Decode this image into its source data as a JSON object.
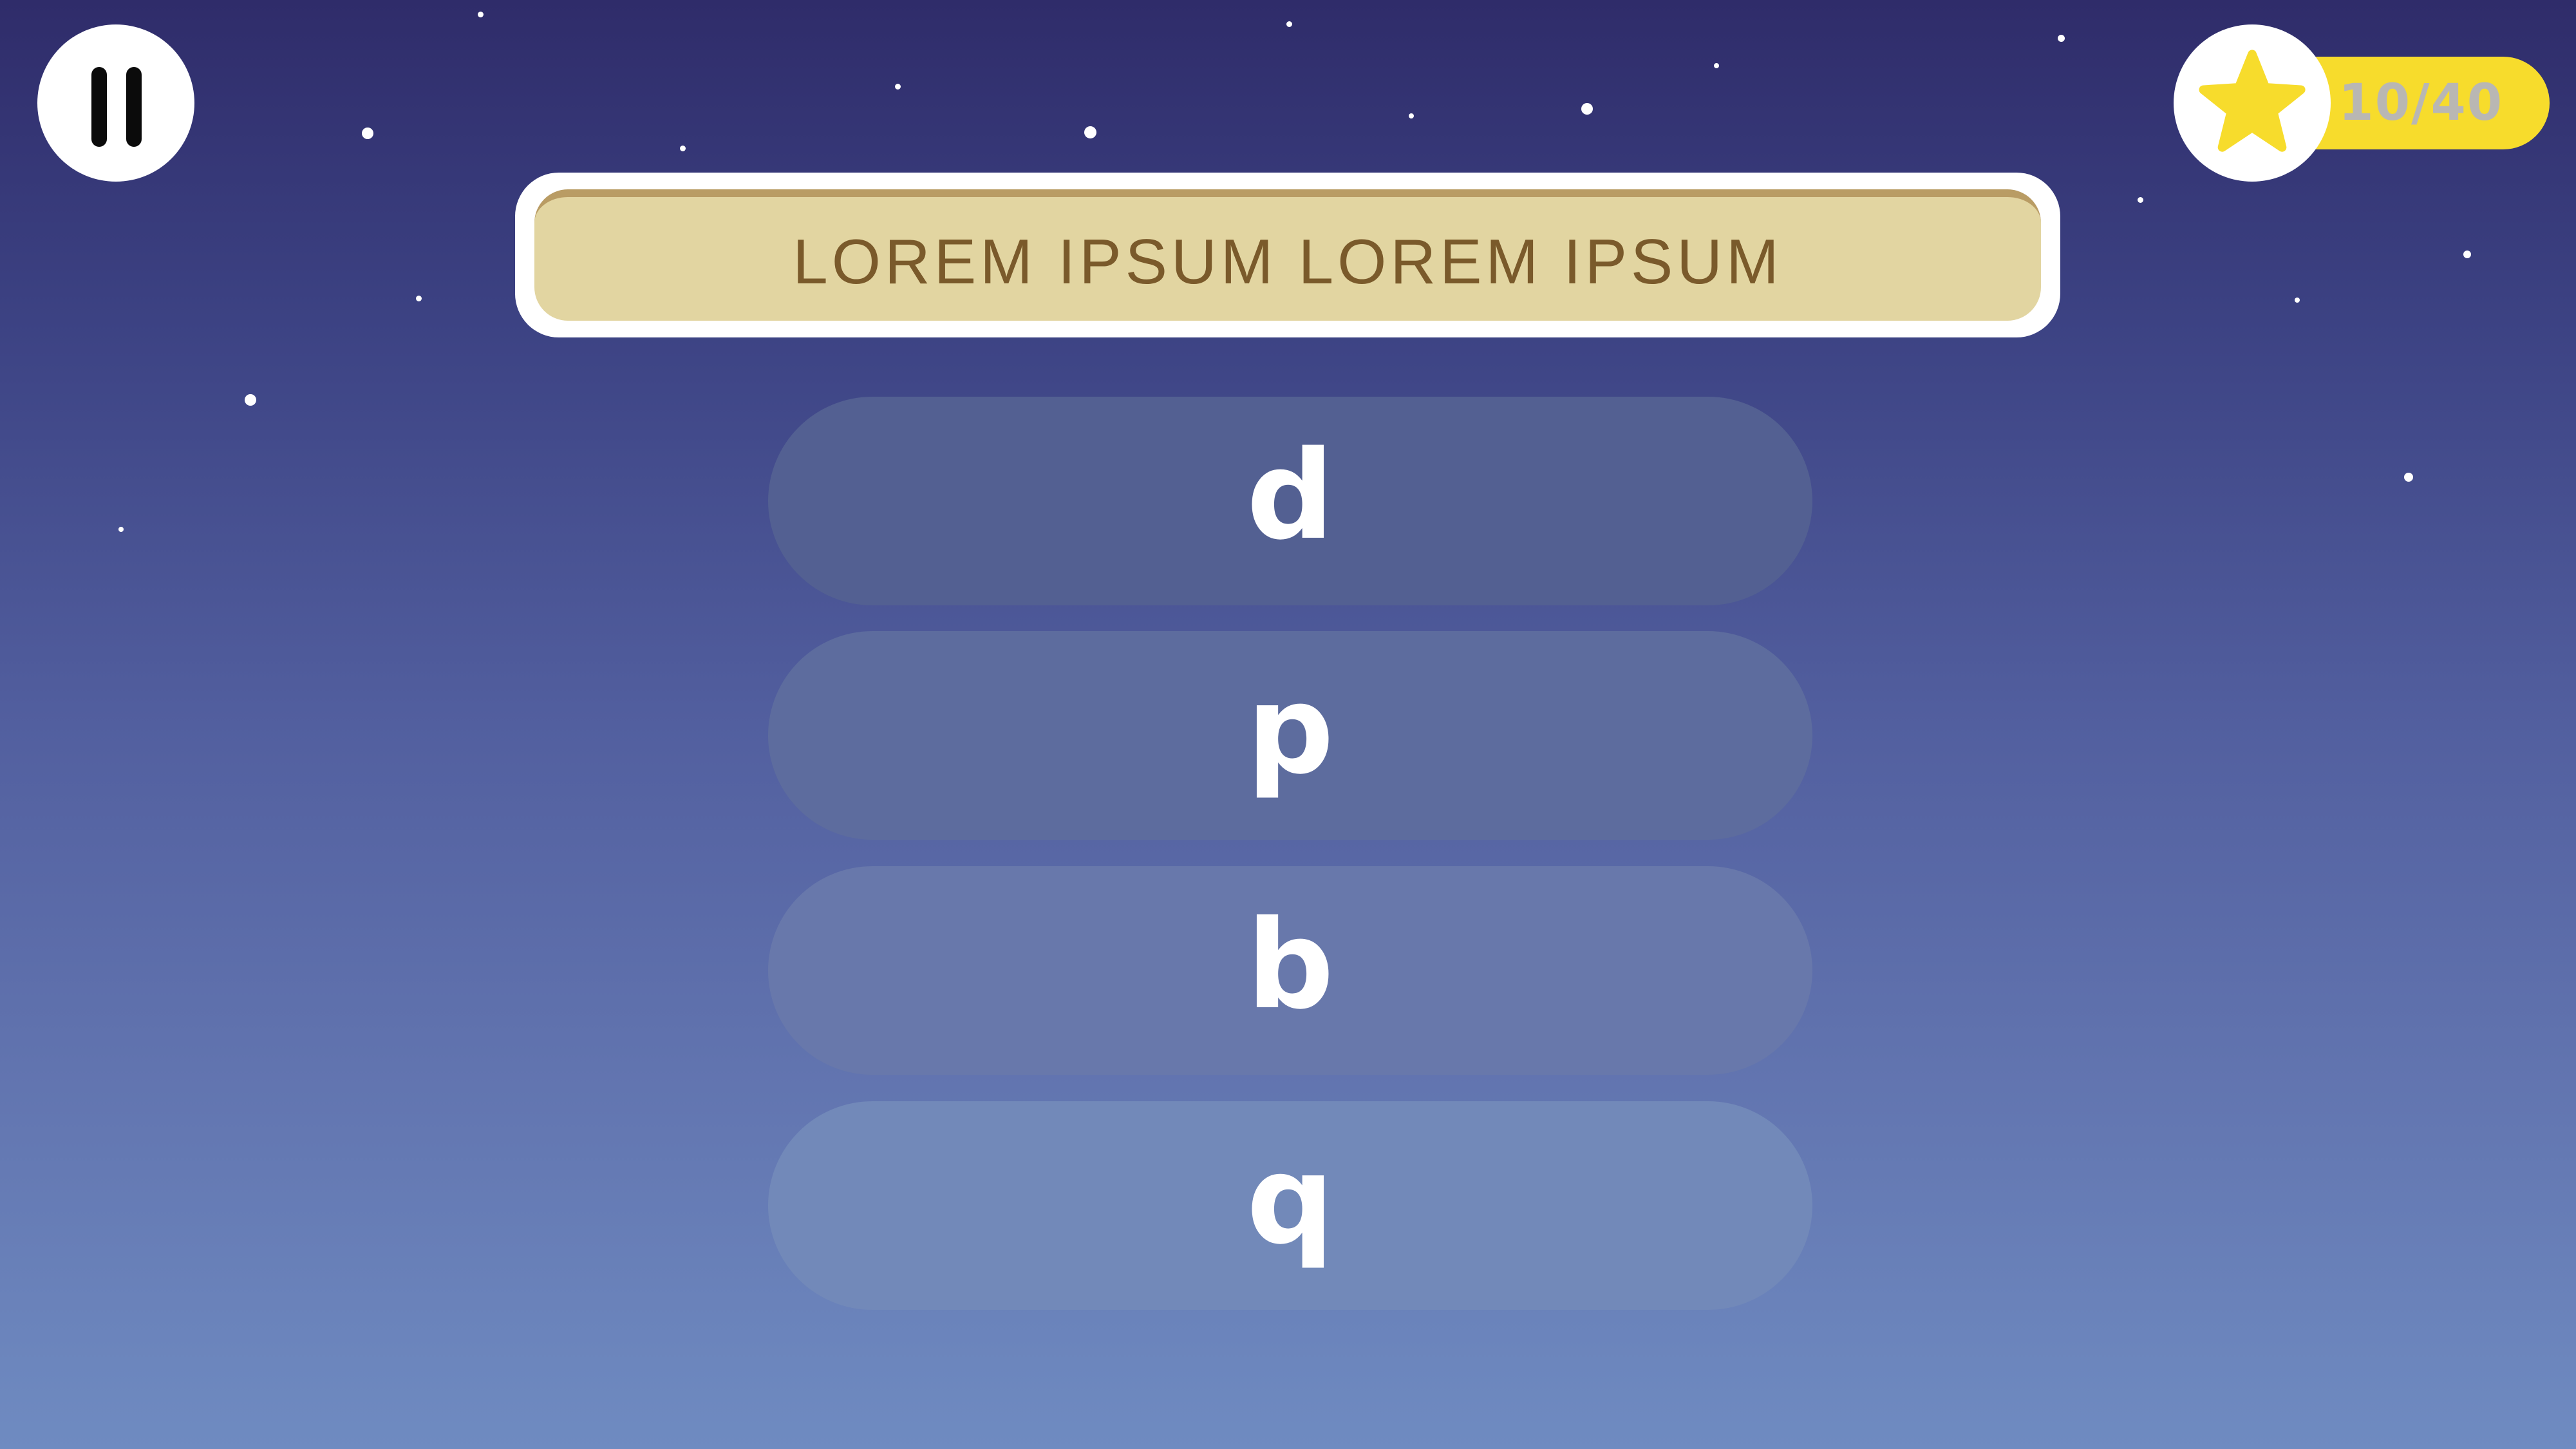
{
  "hud": {
    "pause_icon": "pause-icon",
    "score_icon": "star-icon",
    "score_text": "10/40"
  },
  "prompt": {
    "text": "LOREM IPSUM LOREM IPSUM"
  },
  "answers": [
    {
      "label": "d"
    },
    {
      "label": "p"
    },
    {
      "label": "b"
    },
    {
      "label": "q"
    }
  ],
  "colors": {
    "score_pill": "#f7dc2c",
    "star": "#f7dc2c",
    "prompt_fill": "#e2d5a1",
    "prompt_text": "#7a5a2b",
    "prompt_accent": "#b99c64"
  }
}
